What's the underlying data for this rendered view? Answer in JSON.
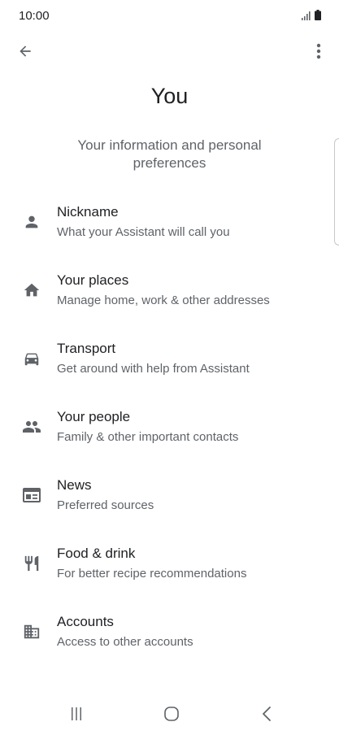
{
  "status_bar": {
    "time": "10:00",
    "icons": [
      "signal-icon",
      "battery-icon"
    ]
  },
  "toolbar": {
    "back_icon": "arrow-back-icon",
    "more_icon": "more-vert-icon"
  },
  "page": {
    "title": "You",
    "subtitle": "Your information and personal preferences"
  },
  "items": [
    {
      "icon": "person-icon",
      "title": "Nickname",
      "subtitle": "What your Assistant will call you"
    },
    {
      "icon": "home-icon",
      "title": "Your places",
      "subtitle": "Manage home, work & other addresses"
    },
    {
      "icon": "car-icon",
      "title": "Transport",
      "subtitle": "Get around with help from Assistant"
    },
    {
      "icon": "people-icon",
      "title": "Your people",
      "subtitle": "Family & other important contacts"
    },
    {
      "icon": "news-icon",
      "title": "News",
      "subtitle": "Preferred sources"
    },
    {
      "icon": "restaurant-icon",
      "title": "Food & drink",
      "subtitle": "For better recipe recommendations"
    },
    {
      "icon": "business-icon",
      "title": "Accounts",
      "subtitle": "Access to other accounts"
    }
  ],
  "nav_bar": {
    "icons": [
      "recents-icon",
      "home-button-icon",
      "back-nav-icon"
    ]
  },
  "colors": {
    "text_primary": "#202124",
    "text_secondary": "#5f6368",
    "icon": "#5f6368",
    "background": "#ffffff"
  }
}
